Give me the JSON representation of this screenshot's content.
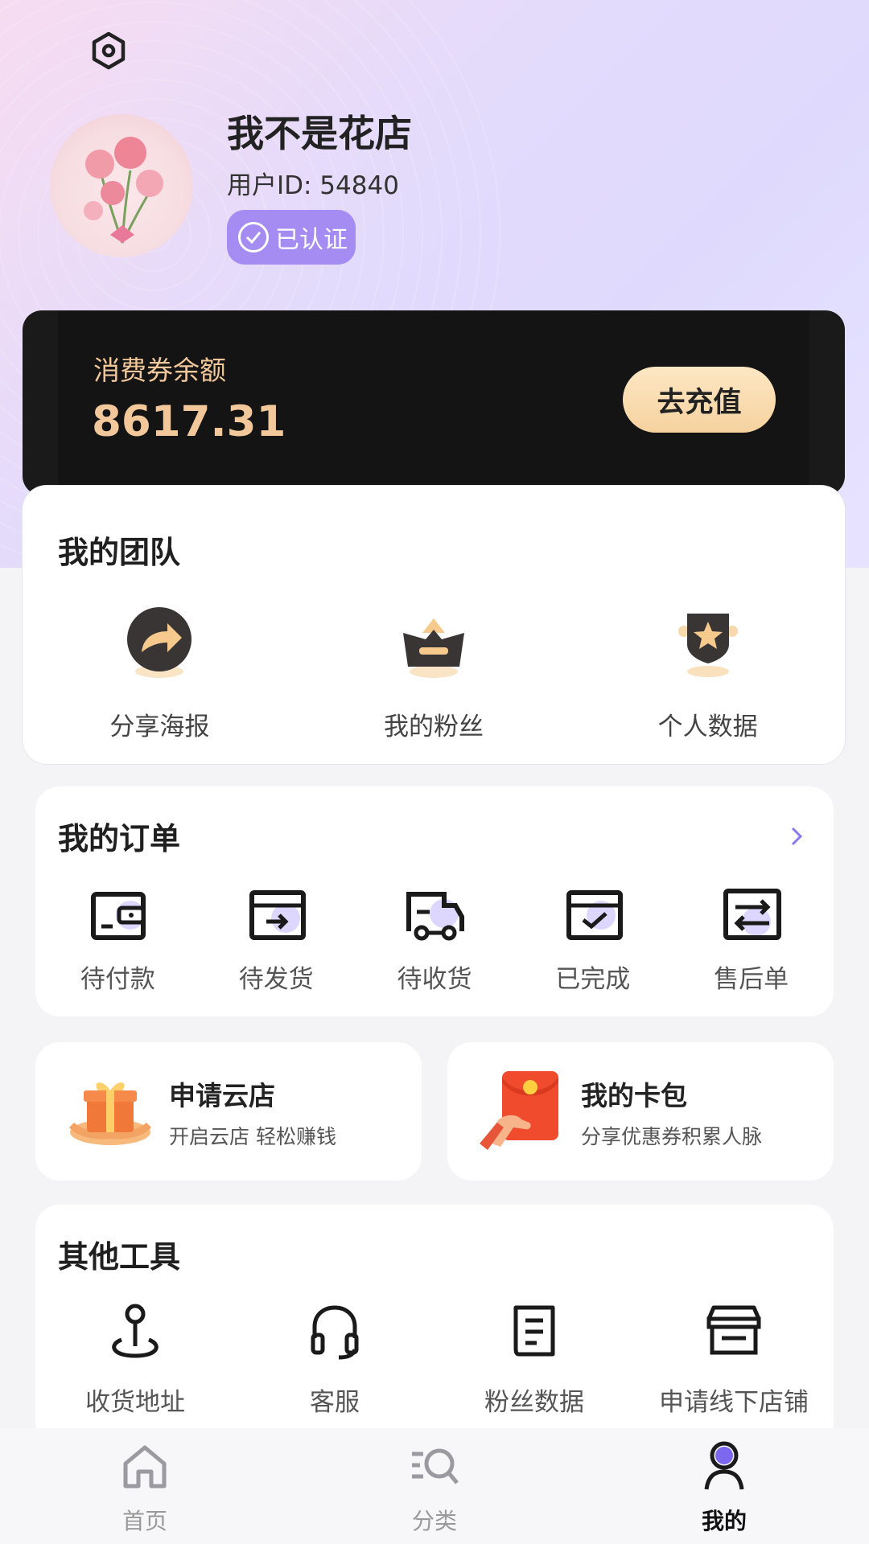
{
  "profile": {
    "name": "我不是花店",
    "user_id": "用户ID: 54840",
    "verified_label": "已认证"
  },
  "wallet": {
    "label": "消费券余额",
    "balance": "8617.31",
    "recharge_label": "去充值"
  },
  "team": {
    "title": "我的团队",
    "items": [
      {
        "label": "分享海报",
        "icon": "share-icon"
      },
      {
        "label": "我的粉丝",
        "icon": "crown-icon"
      },
      {
        "label": "个人数据",
        "icon": "badge-star-icon"
      }
    ]
  },
  "orders": {
    "title": "我的订单",
    "items": [
      {
        "label": "待付款",
        "icon": "wallet-icon"
      },
      {
        "label": "待发货",
        "icon": "ship-box-icon"
      },
      {
        "label": "待收货",
        "icon": "truck-icon"
      },
      {
        "label": "已完成",
        "icon": "check-box-icon"
      },
      {
        "label": "售后单",
        "icon": "exchange-icon"
      }
    ]
  },
  "promos": [
    {
      "title": "申请云店",
      "subtitle": "开启云店 轻松赚钱",
      "icon": "gift-hands-icon"
    },
    {
      "title": "我的卡包",
      "subtitle": "分享优惠券积累人脉",
      "icon": "red-envelope-icon"
    }
  ],
  "tools": {
    "title": "其他工具",
    "items": [
      {
        "label": "收货地址",
        "icon": "location-pin-icon"
      },
      {
        "label": "客服",
        "icon": "headset-icon"
      },
      {
        "label": "粉丝数据",
        "icon": "document-icon"
      },
      {
        "label": "申请线下店铺",
        "icon": "store-icon"
      }
    ]
  },
  "tabbar": {
    "items": [
      {
        "label": "首页",
        "icon": "home-icon"
      },
      {
        "label": "分类",
        "icon": "category-search-icon"
      },
      {
        "label": "我的",
        "icon": "user-icon",
        "active": true
      }
    ]
  },
  "colors": {
    "accent": "#7b68ee",
    "badge": "#a48cf3",
    "gold": "#f2c79a",
    "wallet_bg": "#141414"
  }
}
